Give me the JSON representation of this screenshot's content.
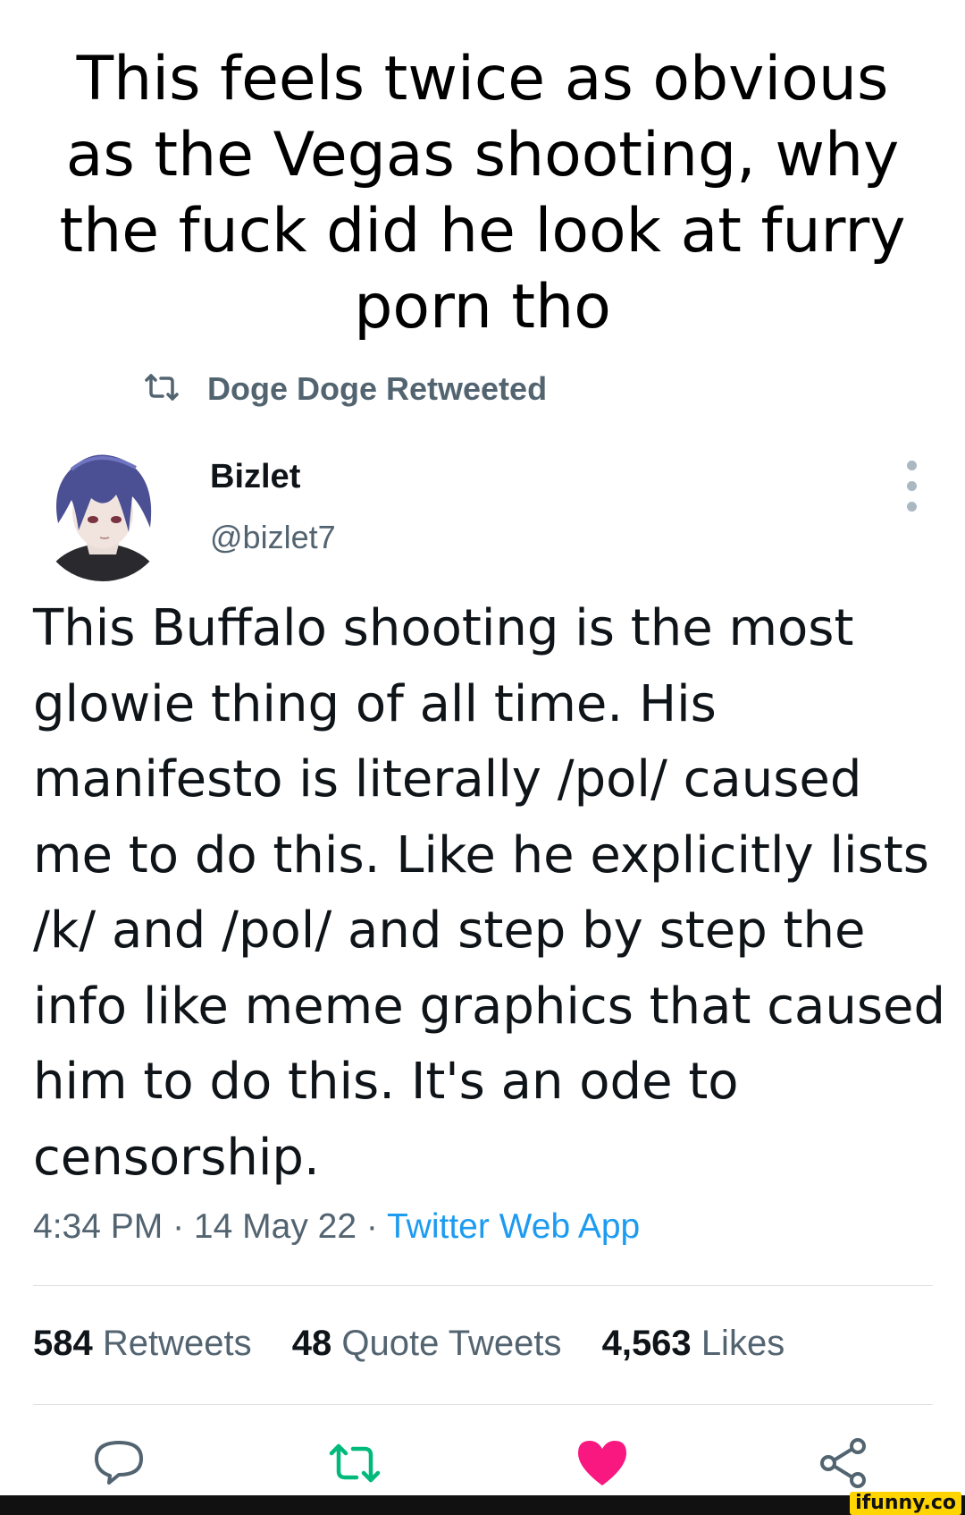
{
  "caption": "This feels twice as obvious as the Vegas shooting, why the fuck did he look at furry porn tho",
  "retweet_banner": "Doge Doge Retweeted",
  "author": {
    "name": "Bizlet",
    "handle": "@bizlet7"
  },
  "tweet_text": "This Buffalo shooting is the most glowie thing of all time. His manifesto is literally /pol/ caused me to do this. Like he explicitly lists /k/ and /pol/ and step by step the info like meme graphics that caused him to do this. It's an ode to censorship.",
  "meta": {
    "time": "4:34 PM",
    "date": "14 May 22",
    "separator": " · ",
    "source": "Twitter Web App"
  },
  "stats": {
    "retweets_count": "584",
    "retweets_label": "Retweets",
    "quotes_count": "48",
    "quotes_label": "Quote Tweets",
    "likes_count": "4,563",
    "likes_label": "Likes"
  },
  "icons": {
    "retweet_banner": "retweet-icon",
    "more": "more-vertical-icon",
    "reply": "reply-icon",
    "retweet": "retweet-icon",
    "like": "heart-icon",
    "share": "share-icon"
  },
  "colors": {
    "retweet_active": "#00ba7c",
    "like_active": "#f91880",
    "link": "#1d9bf0",
    "muted": "#536471"
  },
  "watermark": "ifunny.co"
}
